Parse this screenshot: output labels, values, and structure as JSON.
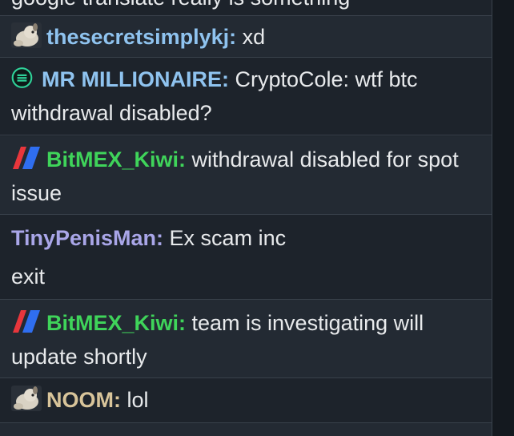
{
  "colors": {
    "thesecretsimplykj": "#8fc3ef",
    "mr_millionaire": "#8fc3ef",
    "bitmex_kiwi": "#3fd45a",
    "tinypenisman": "#a9a6e8",
    "noom": "#d8c49a"
  },
  "messages": [
    {
      "text": "google translate really is something"
    },
    {
      "user": "thesecretsimplykj:",
      "text": " xd",
      "icon": "dog-avatar-icon"
    },
    {
      "user": "MR MILLIONAIRE:",
      "text": " CryptoCole: wtf btc withdrawal disabled?",
      "icon": "green-badge-icon"
    },
    {
      "user": "BitMEX_Kiwi:",
      "text": " withdrawal disabled for spot issue",
      "icon": "bitmex-logo-icon"
    },
    {
      "user": "TinyPenisMan:",
      "text": " Ex scam inc",
      "text2": "exit"
    },
    {
      "user": "BitMEX_Kiwi:",
      "text": " team is investigating will update shortly",
      "icon": "bitmex-logo-icon"
    },
    {
      "user": "NOOM:",
      "text": " lol",
      "icon": "dog-avatar-icon"
    }
  ]
}
